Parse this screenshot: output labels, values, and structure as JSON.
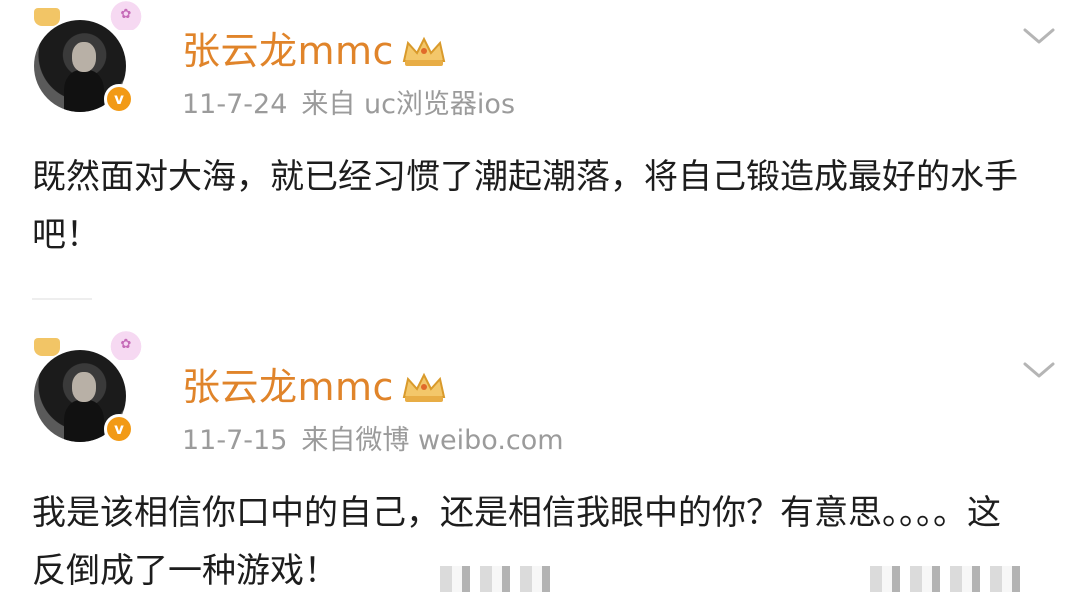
{
  "posts": [
    {
      "username": "张云龙mmc",
      "time": "11-7-24",
      "source": "来自 uc浏览器ios",
      "content": "既然面对大海，就已经习惯了潮起潮落，将自己锻造成最好的水手吧！"
    },
    {
      "username": "张云龙mmc",
      "time": "11-7-15",
      "source": "来自微博 weibo.com",
      "content": "我是该相信你口中的自己，还是相信我眼中的你？有意思。。。。这反倒成了一种游戏！"
    }
  ],
  "icons": {
    "verified": "verified-v-icon",
    "crown": "crown-icon",
    "menu": "chevron-down-icon"
  },
  "colors": {
    "username": "#e0842a",
    "meta": "#9b9b9b",
    "verified_badge": "#f29a16",
    "text": "#1d1d1d"
  }
}
